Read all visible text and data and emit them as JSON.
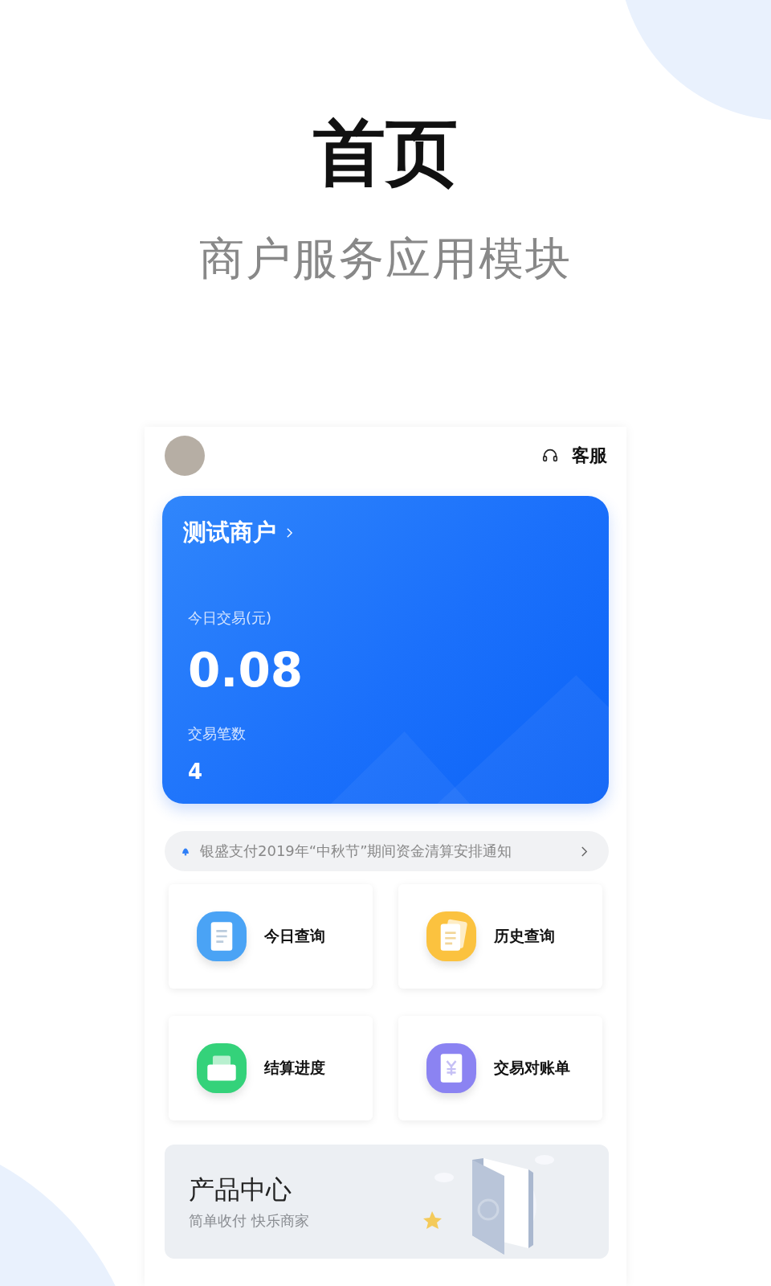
{
  "promo": {
    "title": "首页",
    "subtitle": "商户服务应用模块"
  },
  "header": {
    "service_label": "客服"
  },
  "account_card": {
    "merchant_name": "测试商户",
    "today_label": "今日交易(元)",
    "today_amount": "0.08",
    "count_label": "交易笔数",
    "count": "4"
  },
  "notice": {
    "text": "银盛支付2019年“中秋节”期间资金清算安排通知"
  },
  "tiles": [
    {
      "label": "今日查询",
      "kind": "document",
      "color": "#4aa3f5"
    },
    {
      "label": "历史查询",
      "kind": "documents",
      "color": "#fbc23f"
    },
    {
      "label": "结算进度",
      "kind": "tray",
      "color": "#34d27a"
    },
    {
      "label": "交易对账单",
      "kind": "receipt",
      "color": "#8b83f2"
    }
  ],
  "banner": {
    "title": "产品中心",
    "subtitle": "简单收付 快乐商家"
  }
}
